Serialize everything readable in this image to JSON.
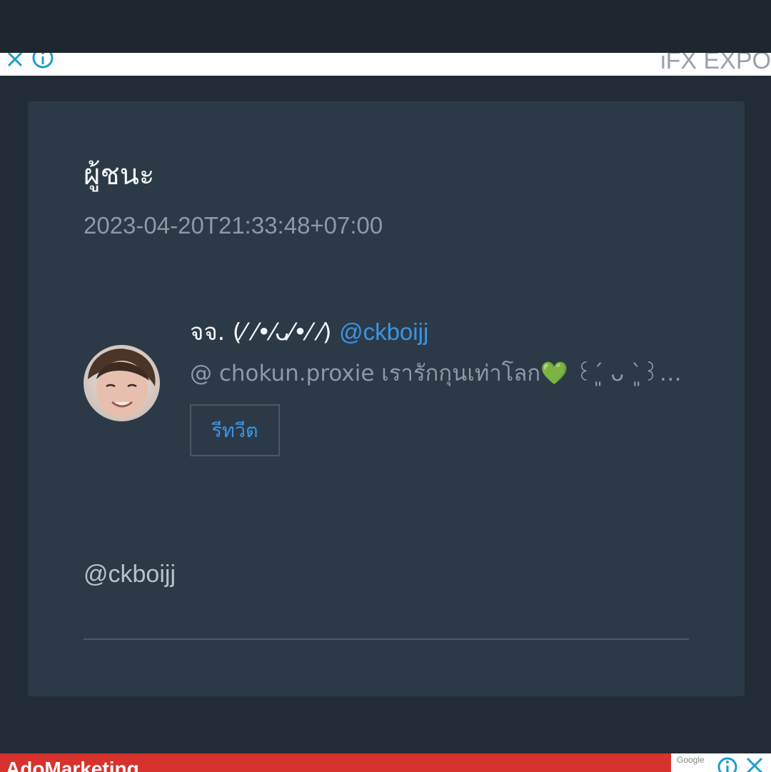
{
  "ad_banner": {
    "brand_text": "iFX EXPO",
    "close_icon": "close-icon",
    "info_icon": "info-icon",
    "accent_color": "#1e9fc8"
  },
  "post": {
    "title": "ผู้ชนะ",
    "timestamp": "2023-04-20T21:33:48+07:00",
    "tweet": {
      "display_name": "จจ. (⁄ ⁄•⁄ᴗ⁄•⁄ ⁄)",
      "handle": "@ckboijj",
      "text": "@ chokun.proxie เรารักกุนเท่าโลก💚 ꒰´͈ ᴗ `͈꒱…",
      "retweet_label": "รีทวีต",
      "avatar_icon": "avatar-photo"
    },
    "mention": "@ckboijj"
  },
  "bottom_ad": {
    "text": "AdoMarketing",
    "google_label": "Google",
    "background_color": "#d7322d"
  }
}
